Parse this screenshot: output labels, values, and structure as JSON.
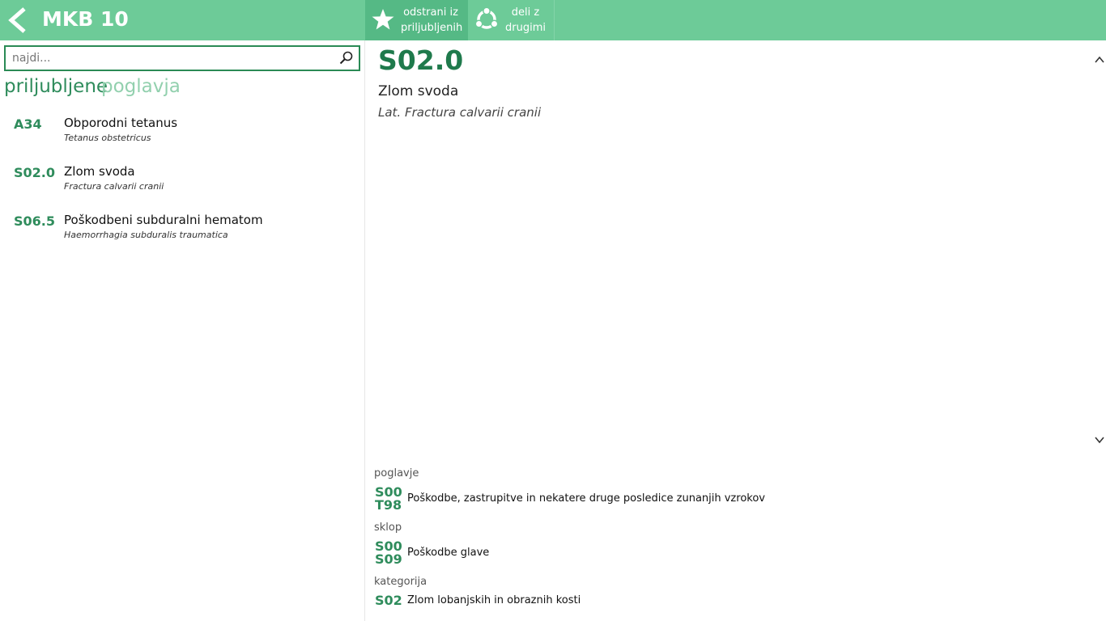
{
  "app": {
    "title": "MKB 10"
  },
  "commands": {
    "unfavorite": {
      "line1": "odstrani iz",
      "line2": "priljubljenih",
      "icon": "star-icon"
    },
    "share": {
      "line1": "deli z",
      "line2": "drugimi",
      "icon": "share-icon"
    }
  },
  "search": {
    "placeholder": "najdi..."
  },
  "pivots": {
    "favorites": "priljubljene",
    "chapters": "poglavja"
  },
  "favorites": [
    {
      "code": "A34",
      "name": "Obporodni tetanus",
      "latin": "Tetanus obstetricus"
    },
    {
      "code": "S02.0",
      "name": "Zlom svoda",
      "latin": "Fractura calvarii cranii"
    },
    {
      "code": "S06.5",
      "name": "Poškodbeni subduralni hematom",
      "latin": "Haemorrhagia subduralis traumatica"
    }
  ],
  "detail": {
    "code": "S02.0",
    "name": "Zlom svoda",
    "latin": "Lat. Fractura calvarii cranii"
  },
  "hierarchy": {
    "chapter": {
      "label": "poglavje",
      "code_from": "S00",
      "code_to": "T98",
      "description": "Poškodbe, zastrupitve in nekatere druge posledice zunanjih vzrokov"
    },
    "block": {
      "label": "sklop",
      "code_from": "S00",
      "code_to": "S09",
      "description": "Poškodbe glave"
    },
    "category": {
      "label": "kategorija",
      "code": "S02",
      "description": "Zlom lobanjskih in obraznih kosti"
    }
  },
  "colors": {
    "topbar": "#6dcb98",
    "accent": "#2f8c5c",
    "active_command": "#55b985"
  }
}
